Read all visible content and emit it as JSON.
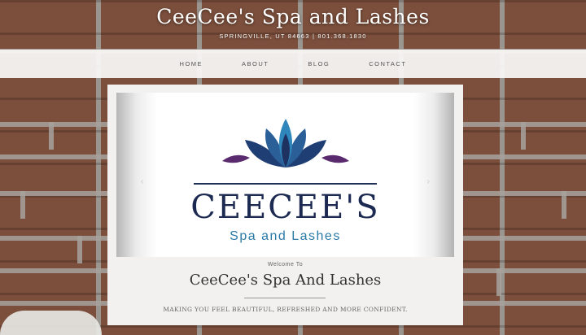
{
  "header": {
    "title": "CeeCee's Spa and Lashes",
    "info": "SPRINGVILLE, UT 84663 | 801.368.1830"
  },
  "nav": {
    "items": [
      {
        "label": "HOME"
      },
      {
        "label": "ABOUT"
      },
      {
        "label": "BLOG"
      },
      {
        "label": "CONTACT"
      }
    ]
  },
  "slider": {
    "prev_arrow": "‹",
    "next_arrow": "›",
    "logo_name": "CEECEE'S",
    "logo_sub": "Spa and Lashes",
    "logo_icon": "lotus-icon"
  },
  "content": {
    "welcome": "Welcome To",
    "heading": "CeeCee's Spa And Lashes",
    "tagline": "MAKING YOU FEEL BEAUTIFUL, REFRESHED AND MORE CONFIDENT."
  },
  "colors": {
    "logo_navy": "#1c2a52",
    "logo_blue": "#2a7aa8",
    "lotus_purple": "#5a2a6e"
  }
}
